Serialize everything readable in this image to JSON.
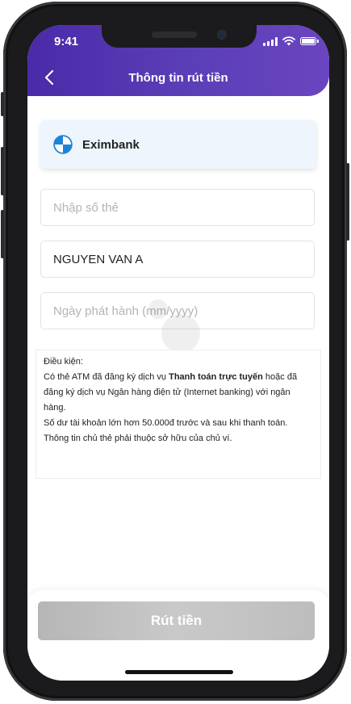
{
  "status_bar": {
    "time": "9:41"
  },
  "header": {
    "title": "Thông tin rút tiền"
  },
  "bank": {
    "name": "Eximbank",
    "logo_icon": "eximbank-logo-icon"
  },
  "form": {
    "card_number_placeholder": "Nhập số thẻ",
    "card_holder_value": "NGUYEN VAN A",
    "issue_date_placeholder": "Ngày phát hành (mm/yyyy)"
  },
  "terms": {
    "heading": "Điều kiện:",
    "line1_prefix": "Có thẻ ATM đã đăng ký dịch vụ ",
    "line1_bold": "Thanh toán trực tuyến",
    "line1_suffix": " hoặc đã đăng ký dịch vụ Ngân hàng điện tử (Internet banking) với ngân hàng.",
    "line2": "Số dư tài khoản lớn hơn 50.000đ trước và sau khi thanh toán.",
    "line3": "Thông tin chủ thẻ phải thuộc sở hữu của chủ ví."
  },
  "action": {
    "submit_label": "Rút tiền"
  },
  "colors": {
    "header_start": "#4a2aa8",
    "header_end": "#6a45c0",
    "bank_card_bg": "#eef5fc",
    "logo_blue": "#1d84d6"
  }
}
